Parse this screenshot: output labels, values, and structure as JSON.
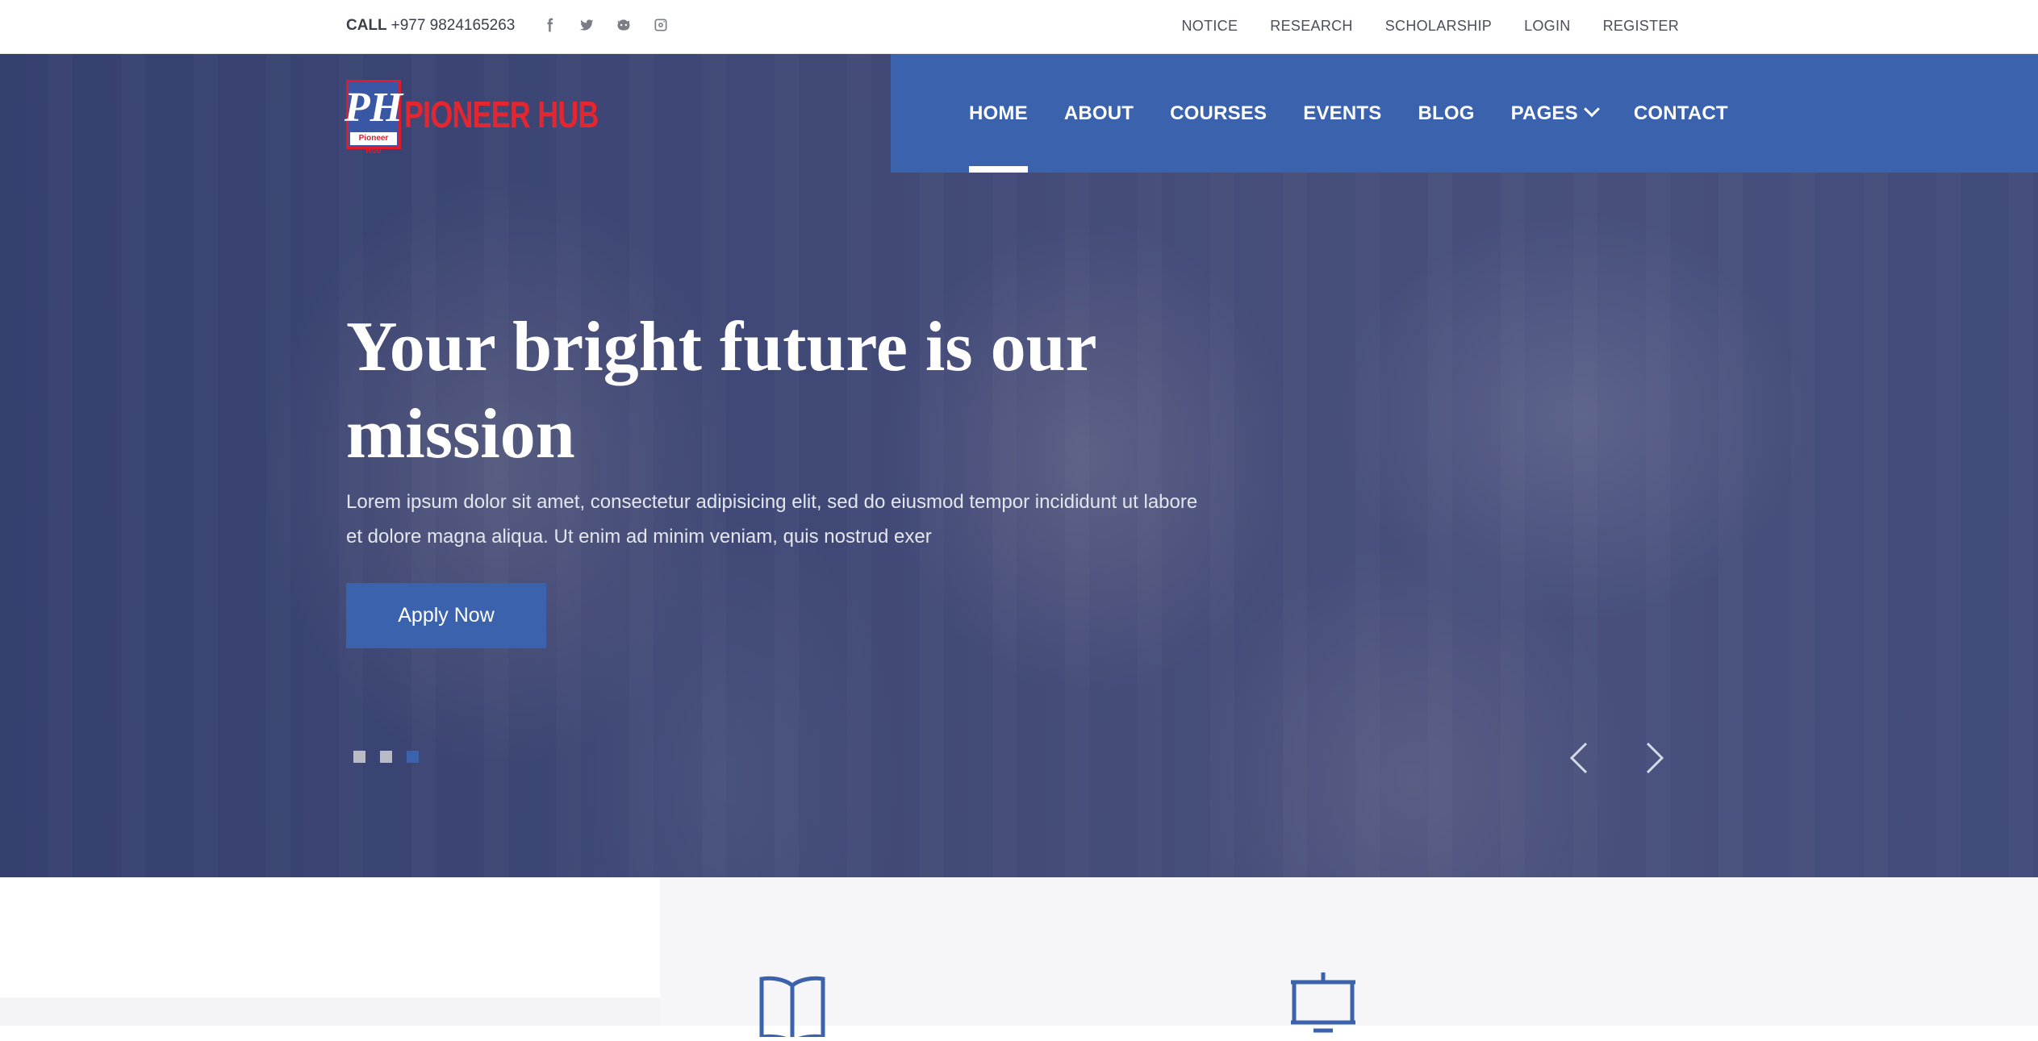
{
  "topbar": {
    "call_label": "CALL",
    "phone": "+977 9824165263",
    "social_icons": [
      "facebook-icon",
      "twitter-icon",
      "github-icon",
      "instagram-icon"
    ],
    "links": [
      "NOTICE",
      "RESEARCH",
      "SCHOLARSHIP",
      "LOGIN",
      "REGISTER"
    ]
  },
  "brand": {
    "mark_text": "PH",
    "mark_sub": "Pioneer Hub",
    "name": "PIONEER HUB"
  },
  "nav": {
    "items": [
      "HOME",
      "ABOUT",
      "COURSES",
      "EVENTS",
      "BLOG",
      "PAGES",
      "CONTACT"
    ],
    "active": "HOME"
  },
  "hero": {
    "title_line1": "Your bright future is our",
    "title_line2": "mission",
    "description": "Lorem ipsum dolor sit amet, consectetur adipisicing elit, sed do eiusmod tempor incididunt ut labore et dolore magna aliqua. Ut enim ad minim veniam, quis nostrud exer",
    "cta_label": "Apply Now",
    "slides_total": 3,
    "active_slide": 3
  },
  "features": {
    "icons": [
      "open-book-icon",
      "presentation-board-icon"
    ]
  },
  "colors": {
    "accent": "#3a62ad",
    "logo_red": "#e3262f",
    "topbar_text": "#4b4f5a"
  }
}
